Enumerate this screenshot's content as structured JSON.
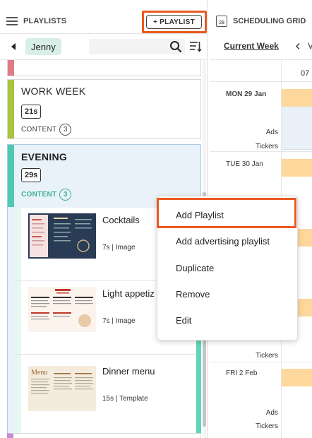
{
  "playlists_panel": {
    "title": "PLAYLISTS",
    "add_button_label": "+ PLAYLIST",
    "user_filter": "Jenny",
    "search_placeholder": "",
    "playlists": [
      {
        "color": "#e07a86"
      },
      {
        "title": "WORK WEEK",
        "duration": "21s",
        "content_label": "CONTENT",
        "content_count": "3",
        "color": "#a9c53b"
      },
      {
        "title": "EVENING",
        "duration": "29s",
        "content_label": "CONTENT",
        "content_count": "3",
        "color": "#4fc9b0",
        "selected": true,
        "items": [
          {
            "name": "Cocktails",
            "duration": "7s",
            "type": "Image",
            "icon": "cocktail-menu-thumbnail"
          },
          {
            "name": "Light appetiz",
            "duration": "7s",
            "type": "Image",
            "icon": "restaurant-menu-thumbnail"
          },
          {
            "name": "Dinner menu",
            "duration": "15s",
            "type": "Template",
            "icon": "dinner-menu-thumbnail"
          }
        ]
      }
    ]
  },
  "scheduling_grid": {
    "title": "SCHEDULING GRID",
    "calendar_day": "28",
    "week_link": "Current Week",
    "next_partial": "V",
    "hour": "07",
    "days": [
      {
        "label": "MON 29 Jan",
        "bold": true,
        "rows": [
          "Ads",
          "Tickers"
        ]
      },
      {
        "label": "TUE 30 Jan",
        "bold": false,
        "rows": []
      },
      {
        "label": "",
        "bold": false,
        "rows": [
          "Tickers"
        ]
      },
      {
        "label": "FRI 2 Feb",
        "bold": false,
        "rows": [
          "Ads",
          "Tickers"
        ]
      }
    ]
  },
  "context_menu": {
    "items": [
      "Add Playlist",
      "Add advertising playlist",
      "Duplicate",
      "Remove",
      "Edit"
    ],
    "highlighted": "Add Playlist"
  },
  "colors": {
    "accent_highlight": "#ea5a1f",
    "user_chip": "#d8efe5",
    "schedule_slot": "#fdd79b",
    "evening_content": "#3bb08f"
  }
}
